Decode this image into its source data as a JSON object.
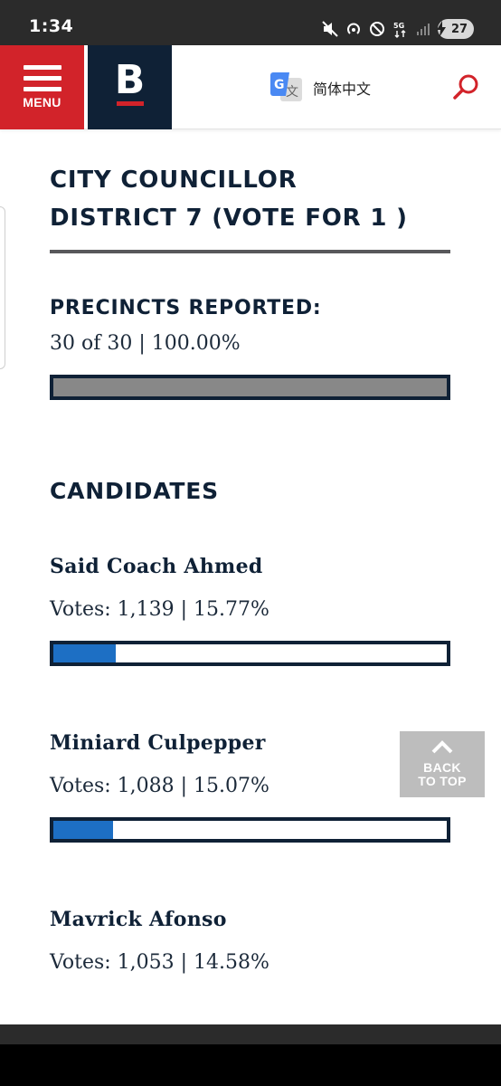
{
  "status_bar": {
    "time": "1:34",
    "battery": "27",
    "icons": [
      "mute-icon",
      "hotspot-icon",
      "do-not-disturb-icon",
      "5g-icon",
      "signal-icon",
      "battery-icon"
    ]
  },
  "header": {
    "menu_label": "MENU",
    "logo_letter": "B",
    "translate_label": "简体中文",
    "colors": {
      "menu_bg": "#d2232a",
      "logo_bg": "#0f2136",
      "accent": "#d2232a"
    }
  },
  "race": {
    "title_line1": "CITY COUNCILLOR",
    "title_line2": "DISTRICT 7 (VOTE FOR 1 )"
  },
  "precincts": {
    "label": "PRECINCTS REPORTED:",
    "summary": "30 of 30 | 100.00%",
    "fraction": 1.0
  },
  "candidates": {
    "heading": "CANDIDATES",
    "items": [
      {
        "name": "Said Coach Ahmed",
        "votes_text": "Votes: 1,139 | 15.77%",
        "percent": 15.77
      },
      {
        "name": "Miniard Culpepper",
        "votes_text": "Votes: 1,088 | 15.07%",
        "percent": 15.07
      },
      {
        "name": "Mavrick Afonso",
        "votes_text": "Votes: 1,053 | 14.58%",
        "percent": 14.58
      }
    ]
  },
  "back_to_top": {
    "line1": "BACK",
    "line2": "TO TOP"
  },
  "colors": {
    "bar_fill": "#1d6fc4",
    "precinct_fill": "#888888",
    "bar_border": "#0f2136"
  }
}
